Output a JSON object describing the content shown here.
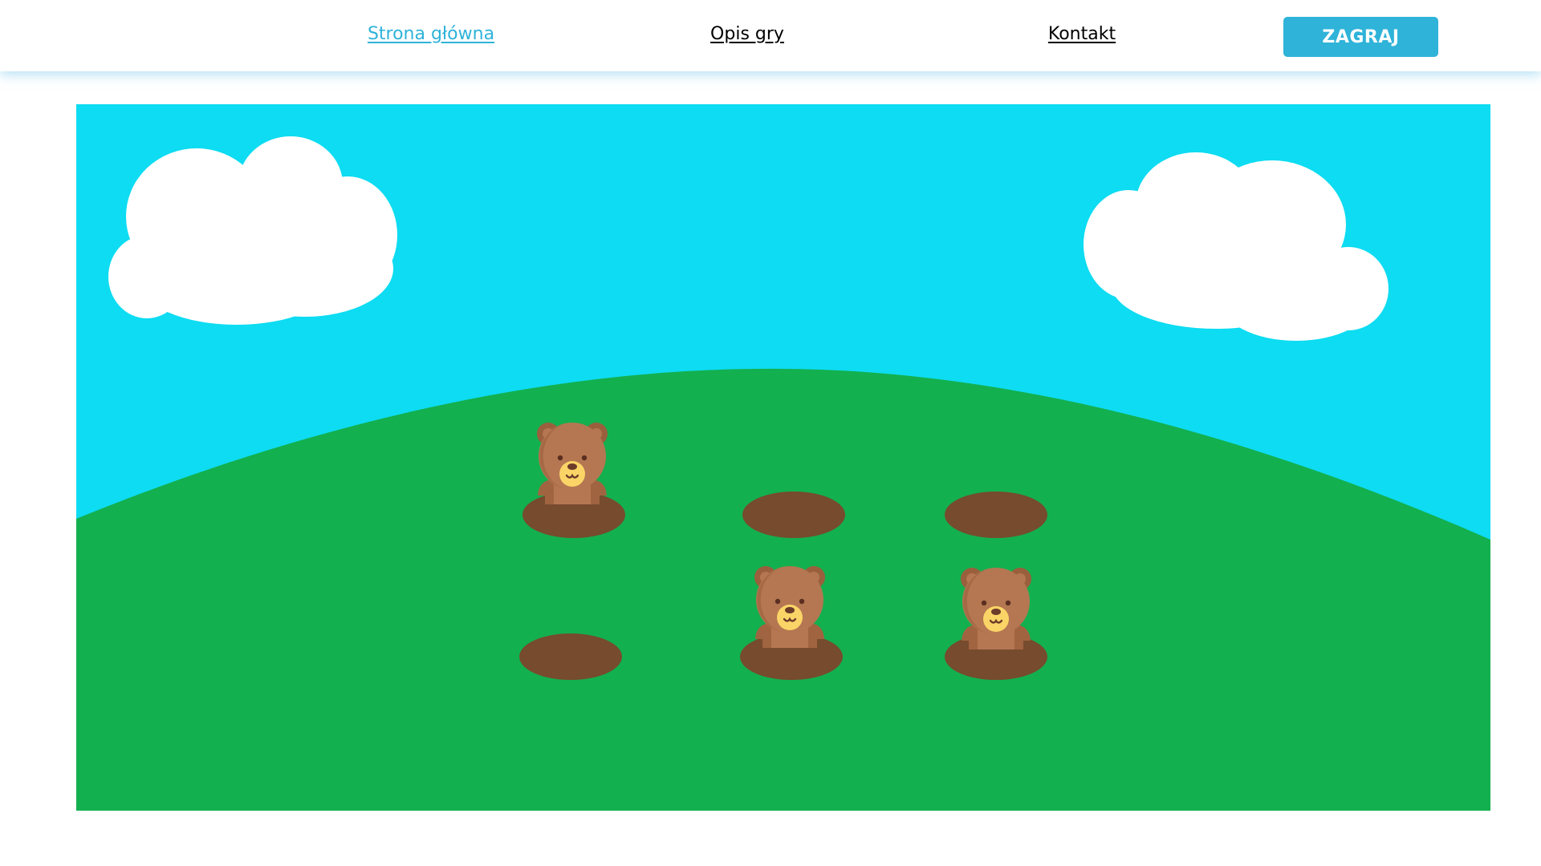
{
  "nav": {
    "links": [
      {
        "label": "Strona główna",
        "active": true
      },
      {
        "label": "Opis gry",
        "active": false
      },
      {
        "label": "Kontakt",
        "active": false
      }
    ],
    "play_button": "ZAGRAJ"
  },
  "game": {
    "colors": {
      "sky": "#0ddcf2",
      "grass": "#13b04f",
      "hole": "#774b2d",
      "cloud": "#ffffff",
      "bear_fur": "#b47752",
      "bear_ear": "#9a5f3d",
      "bear_muzzle": "#fbd467",
      "bear_nose": "#6b3b2a",
      "accent": "#2fb3d9"
    },
    "holes": [
      {
        "row": 1,
        "col": 1,
        "bear": true
      },
      {
        "row": 1,
        "col": 2,
        "bear": false
      },
      {
        "row": 1,
        "col": 3,
        "bear": false
      },
      {
        "row": 2,
        "col": 1,
        "bear": false
      },
      {
        "row": 2,
        "col": 2,
        "bear": true
      },
      {
        "row": 2,
        "col": 3,
        "bear": true
      }
    ]
  }
}
